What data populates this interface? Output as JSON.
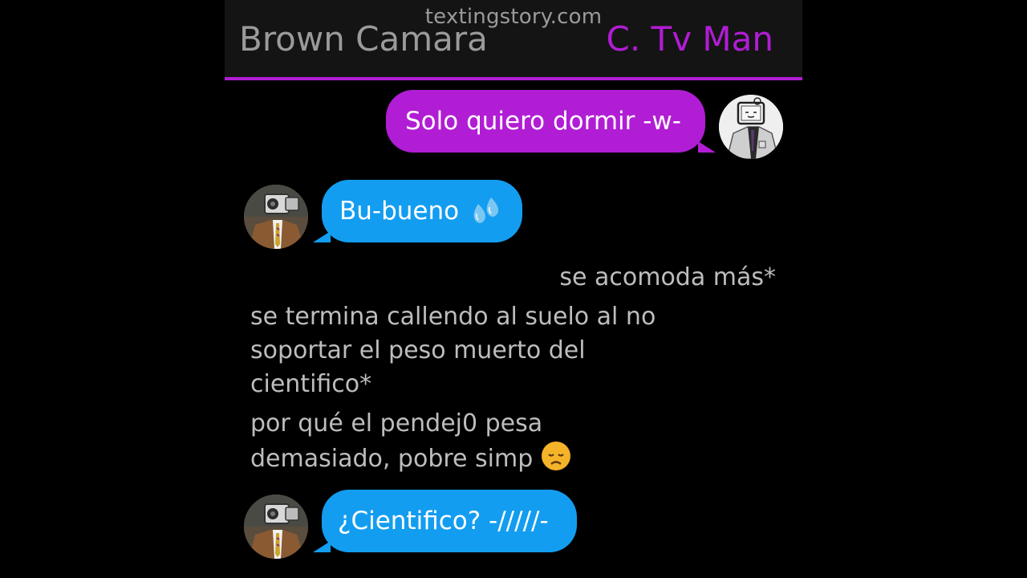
{
  "header": {
    "watermark": "textingstory.com",
    "left_name": "Brown Camara",
    "right_name": "C. Tv Man",
    "accent_color": "#b11dd4"
  },
  "messages": [
    {
      "sender": "C. Tv Man",
      "text": "Solo quiero dormir -w-",
      "bubble_color": "#b11dd4",
      "avatar_icon": "tv-man-avatar"
    },
    {
      "sender": "Brown Camara",
      "text": "Bu-bueno",
      "emoji": "sweat-droplets-emoji",
      "bubble_color": "#139df0",
      "avatar_icon": "camera-man-avatar"
    },
    {
      "narration": "se acomoda más*"
    },
    {
      "narration_lines": [
        "se termina callendo al suelo al no",
        "soportar el peso muerto del",
        "cientifico*"
      ]
    },
    {
      "narration_lines": [
        "por qué el pendej0 pesa",
        "demasiado, pobre simp"
      ],
      "emoji": "disappointed-face-emoji"
    },
    {
      "sender": "Brown Camara",
      "text": "¿Cientifico? -/////-",
      "bubble_color": "#139df0",
      "avatar_icon": "camera-man-avatar"
    }
  ]
}
